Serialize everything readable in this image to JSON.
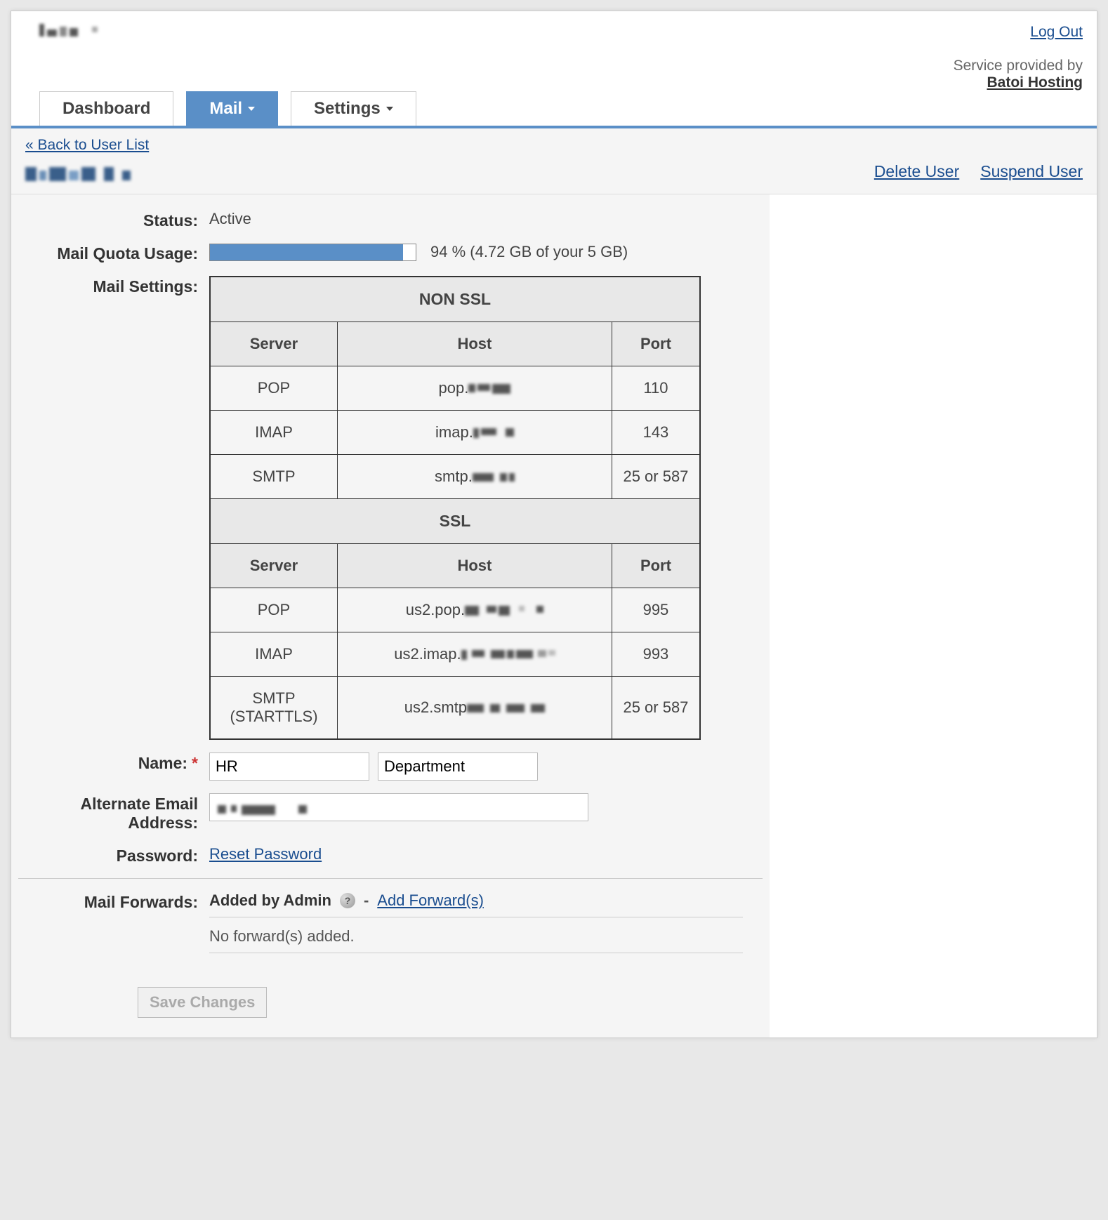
{
  "header": {
    "logout": "Log Out",
    "service_text": "Service provided by",
    "service_link": "Batoi Hosting"
  },
  "tabs": {
    "dashboard": "Dashboard",
    "mail": "Mail",
    "settings": "Settings"
  },
  "page": {
    "back_link": "« Back to User List",
    "delete_user": "Delete User",
    "suspend_user": "Suspend User"
  },
  "labels": {
    "status": "Status:",
    "quota": "Mail Quota Usage:",
    "settings": "Mail Settings:",
    "name": "Name:",
    "alt_email": "Alternate Email Address:",
    "password": "Password:",
    "forwards": "Mail Forwards:"
  },
  "status_value": "Active",
  "quota": {
    "percent": 94,
    "text": "94 % (4.72 GB of your 5 GB)"
  },
  "mail_settings": {
    "non_ssl": {
      "title": "NON SSL",
      "col_server": "Server",
      "col_host": "Host",
      "col_port": "Port",
      "rows": [
        {
          "server": "POP",
          "host_prefix": "pop.",
          "port": "110"
        },
        {
          "server": "IMAP",
          "host_prefix": "imap.",
          "port": "143"
        },
        {
          "server": "SMTP",
          "host_prefix": "smtp.",
          "port": "25 or 587"
        }
      ]
    },
    "ssl": {
      "title": "SSL",
      "col_server": "Server",
      "col_host": "Host",
      "col_port": "Port",
      "rows": [
        {
          "server": "POP",
          "host_prefix": "us2.pop.",
          "port": "995"
        },
        {
          "server": "IMAP",
          "host_prefix": "us2.imap.",
          "port": "993"
        },
        {
          "server": "SMTP (STARTTLS)",
          "host_prefix": "us2.smtp",
          "port": "25 or 587"
        }
      ]
    }
  },
  "name": {
    "first": "HR",
    "last": "Department"
  },
  "password_link": "Reset Password",
  "forwards": {
    "added_by": "Added by Admin",
    "add_link": "Add Forward(s)",
    "empty": "No forward(s) added."
  },
  "save_button": "Save Changes"
}
